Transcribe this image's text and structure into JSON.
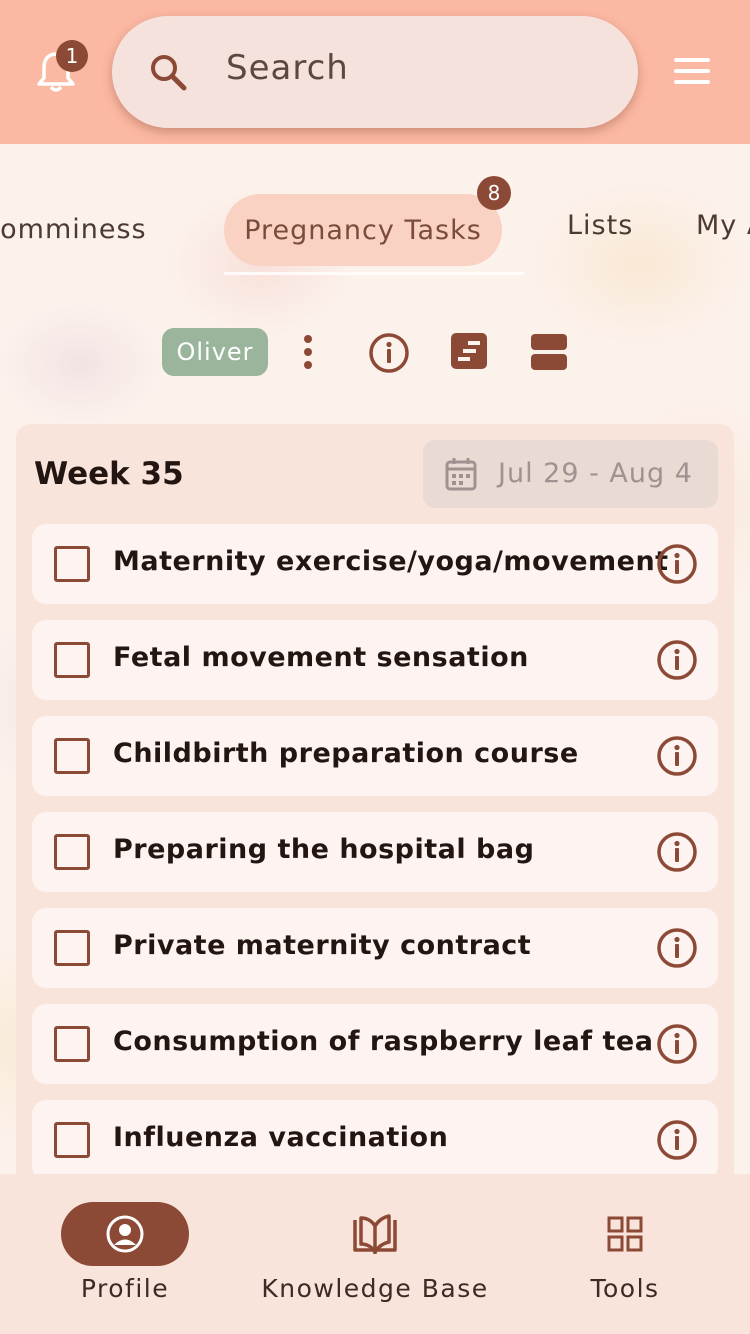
{
  "header": {
    "notification_count": "1",
    "search_placeholder": "Search"
  },
  "tabs": {
    "items": [
      "Somminess",
      "Pregnancy Tasks",
      "Lists",
      "My A"
    ],
    "active": "Pregnancy Tasks",
    "active_badge": "8"
  },
  "toolbar": {
    "child_name": "Oliver"
  },
  "week": {
    "title": "Week 35",
    "date_range": "Jul 29 - Aug 4"
  },
  "tasks": [
    {
      "label": "Maternity exercise/yoga/movement",
      "checked": false
    },
    {
      "label": "Fetal movement sensation",
      "checked": false
    },
    {
      "label": "Childbirth preparation course",
      "checked": false
    },
    {
      "label": "Preparing the hospital bag",
      "checked": false
    },
    {
      "label": "Private maternity contract",
      "checked": false
    },
    {
      "label": "Consumption of raspberry leaf tea",
      "checked": false
    },
    {
      "label": "Influenza vaccination",
      "checked": false
    }
  ],
  "bottom_nav": {
    "profile": "Profile",
    "knowledge_base": "Knowledge Base",
    "tools": "Tools",
    "active": "Profile"
  },
  "colors": {
    "header": "#fbb8a2",
    "accent": "#8c4a36",
    "chip": "#9bb59c",
    "card": "#f9e4dc"
  }
}
